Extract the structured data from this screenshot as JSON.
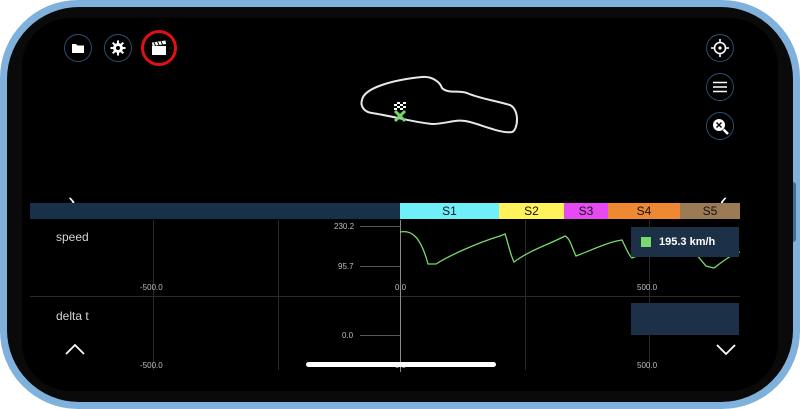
{
  "toolbar": {
    "folder_icon": "folder-icon",
    "settings_icon": "gear-icon",
    "clapper_icon": "clapperboard-icon",
    "highlight_color": "#e11111"
  },
  "right_toolbar": {
    "target_icon": "crosshair-icon",
    "menu_icon": "hamburger-menu-icon",
    "zoom_icon": "zoom-icon"
  },
  "sectors": [
    {
      "label": "S1",
      "color": "#6ff0f8"
    },
    {
      "label": "S2",
      "color": "#fff25a"
    },
    {
      "label": "S3",
      "color": "#e54bf0"
    },
    {
      "label": "S4",
      "color": "#ee8833"
    },
    {
      "label": "S5",
      "color": "#9b7b55"
    }
  ],
  "speed_panel": {
    "label": "speed",
    "y_max": "230.2",
    "y_min": "95.7",
    "x_ticks": [
      "-500.0",
      "0.0",
      "500.0"
    ],
    "current_value": "195.3 km/h",
    "series_color": "#77d96d"
  },
  "delta_panel": {
    "label": "delta t",
    "y_zero": "0.0",
    "x_ticks": [
      "-500.0",
      "0.0",
      "500.0"
    ]
  },
  "nav": {
    "up_icon": "chevron-up-icon",
    "down_icon": "chevron-down-icon",
    "left_icon": "chevron-left-icon",
    "right_icon": "chevron-right-icon"
  }
}
